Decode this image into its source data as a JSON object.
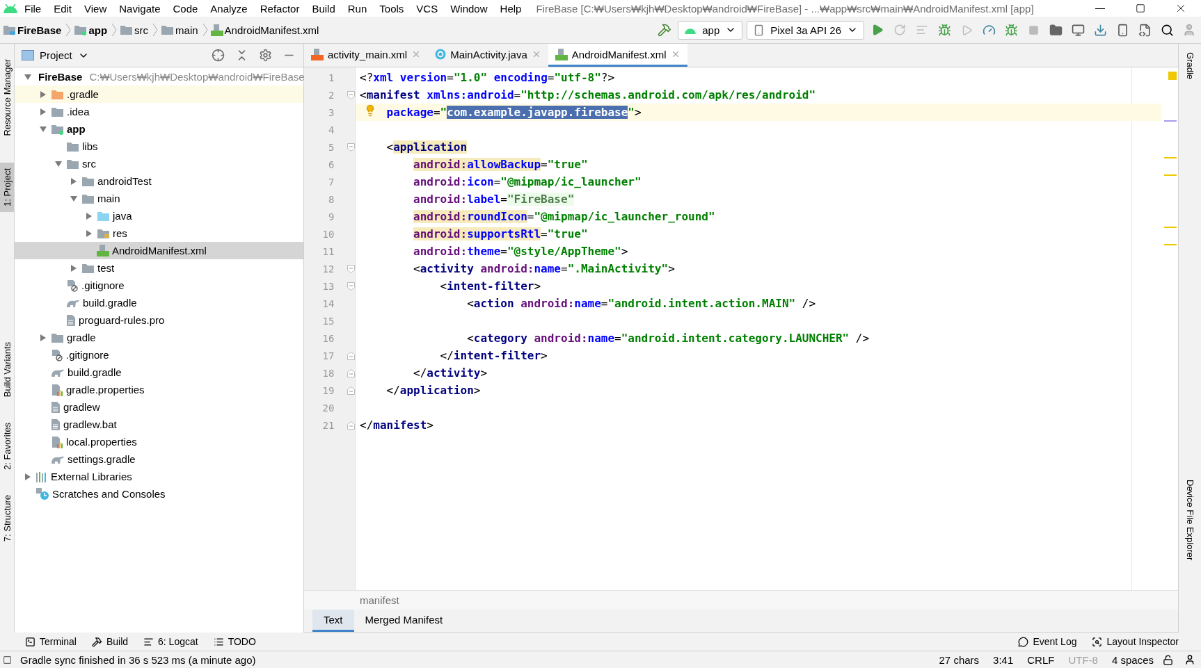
{
  "window": {
    "title": "FireBase [C:₩Users₩kjh₩Desktop₩android₩FireBase] - ...₩app₩src₩main₩AndroidManifest.xml [app]"
  },
  "menu": [
    "File",
    "Edit",
    "View",
    "Navigate",
    "Code",
    "Analyze",
    "Refactor",
    "Build",
    "Run",
    "Tools",
    "VCS",
    "Window",
    "Help"
  ],
  "breadcrumbs": [
    {
      "label": "FireBase",
      "kind": "project"
    },
    {
      "label": "app",
      "kind": "module"
    },
    {
      "label": "src",
      "kind": "folder"
    },
    {
      "label": "main",
      "kind": "folder"
    },
    {
      "label": "AndroidManifest.xml",
      "kind": "manifest"
    }
  ],
  "toolbar": {
    "run_config": "app",
    "device": "Pixel 3a API 26"
  },
  "left_stripe": [
    {
      "label": "Resource Manager",
      "selected": false
    },
    {
      "label": "1: Project",
      "selected": true
    },
    {
      "label": "Build Variants",
      "selected": false
    },
    {
      "label": "2: Favorites",
      "selected": false
    },
    {
      "label": "7: Structure",
      "selected": false
    }
  ],
  "right_stripe": [
    {
      "label": "Gradle",
      "selected": false
    },
    {
      "label": "Device File Explorer",
      "selected": false
    }
  ],
  "project_panel": {
    "title": "Project",
    "tree": [
      {
        "label": "FireBase",
        "hint": "C:₩Users₩kjh₩Desktop₩android₩FireBase",
        "kind": "project",
        "expanded": true,
        "selected": false,
        "highlighted": false,
        "children": [
          {
            "label": ".gradle",
            "kind": "excluded",
            "expanded": false,
            "selected": false,
            "highlighted": true
          },
          {
            "label": ".idea",
            "kind": "folder",
            "expanded": false,
            "selected": false,
            "highlighted": false
          },
          {
            "label": "app",
            "kind": "module",
            "expanded": true,
            "selected": false,
            "highlighted": false,
            "children": [
              {
                "label": "libs",
                "kind": "folder",
                "selected": false,
                "highlighted": false
              },
              {
                "label": "src",
                "kind": "folder",
                "expanded": true,
                "selected": false,
                "highlighted": false,
                "children": [
                  {
                    "label": "androidTest",
                    "kind": "folder",
                    "expanded": false,
                    "selected": false,
                    "highlighted": false
                  },
                  {
                    "label": "main",
                    "kind": "folder",
                    "expanded": true,
                    "selected": false,
                    "highlighted": false,
                    "children": [
                      {
                        "label": "java",
                        "kind": "source",
                        "expanded": false,
                        "selected": false,
                        "highlighted": false
                      },
                      {
                        "label": "res",
                        "kind": "resources",
                        "expanded": false,
                        "selected": false,
                        "highlighted": false
                      },
                      {
                        "label": "AndroidManifest.xml",
                        "kind": "manifest",
                        "selected": true,
                        "highlighted": false
                      }
                    ]
                  },
                  {
                    "label": "test",
                    "kind": "folder",
                    "expanded": false,
                    "selected": false,
                    "highlighted": false
                  }
                ]
              },
              {
                "label": ".gitignore",
                "kind": "gitignore",
                "selected": false,
                "highlighted": false
              },
              {
                "label": "build.gradle",
                "kind": "gradle",
                "selected": false,
                "highlighted": false
              },
              {
                "label": "proguard-rules.pro",
                "kind": "text",
                "selected": false,
                "highlighted": false
              }
            ]
          },
          {
            "label": "gradle",
            "kind": "folder",
            "expanded": false,
            "selected": false,
            "highlighted": false
          },
          {
            "label": ".gitignore",
            "kind": "gitignore",
            "selected": false,
            "highlighted": false
          },
          {
            "label": "build.gradle",
            "kind": "gradle",
            "selected": false,
            "highlighted": false
          },
          {
            "label": "gradle.properties",
            "kind": "properties",
            "selected": false,
            "highlighted": false
          },
          {
            "label": "gradlew",
            "kind": "text",
            "selected": false,
            "highlighted": false
          },
          {
            "label": "gradlew.bat",
            "kind": "text",
            "selected": false,
            "highlighted": false
          },
          {
            "label": "local.properties",
            "kind": "properties",
            "selected": false,
            "highlighted": false
          },
          {
            "label": "settings.gradle",
            "kind": "gradle",
            "selected": false,
            "highlighted": false
          }
        ]
      },
      {
        "label": "External Libraries",
        "kind": "libraries",
        "expanded": false,
        "selected": false,
        "highlighted": false
      },
      {
        "label": "Scratches and Consoles",
        "kind": "scratches",
        "selected": false,
        "highlighted": false
      }
    ]
  },
  "editor_tabs": [
    {
      "label": "activity_main.xml",
      "kind": "layout",
      "selected": false
    },
    {
      "label": "MainActivity.java",
      "kind": "class",
      "selected": false
    },
    {
      "label": "AndroidManifest.xml",
      "kind": "manifest",
      "selected": true
    }
  ],
  "code": [
    {
      "number": "1",
      "kind": "plain",
      "current": false,
      "tokens": [
        {
          "text": "<?",
          "kind": "punct"
        },
        {
          "text": "xml",
          "kind": "attr"
        },
        {
          "text": " version",
          "kind": "attr"
        },
        {
          "text": "=",
          "kind": "punct"
        },
        {
          "text": "\"1.0\"",
          "kind": "value"
        },
        {
          "text": " encoding",
          "kind": "attr"
        },
        {
          "text": "=",
          "kind": "punct"
        },
        {
          "text": "\"utf-8\"",
          "kind": "value"
        },
        {
          "text": "?>",
          "kind": "punct"
        }
      ]
    },
    {
      "number": "2",
      "kind": "fold-start",
      "current": false,
      "tokens": [
        {
          "text": "<",
          "kind": "punct"
        },
        {
          "text": "manifest",
          "kind": "tag"
        },
        {
          "text": " xmlns:android",
          "kind": "attr"
        },
        {
          "text": "=",
          "kind": "punct"
        },
        {
          "text": "\"http://schemas.android.com/apk/res/android\"",
          "kind": "value"
        }
      ]
    },
    {
      "number": "3",
      "kind": "plain",
      "current": true,
      "tokens": [
        {
          "text": "    package",
          "kind": "attr"
        },
        {
          "text": "=",
          "kind": "punct"
        },
        {
          "text": "\"",
          "kind": "value"
        },
        {
          "text": "com.example.javapp.firebase",
          "kind": "value",
          "selected": true
        },
        {
          "text": "\"",
          "kind": "value"
        },
        {
          "text": ">",
          "kind": "punct"
        }
      ]
    },
    {
      "number": "4",
      "kind": "plain",
      "current": false
    },
    {
      "number": "5",
      "kind": "fold-start",
      "current": false,
      "tokens": [
        {
          "text": "    <",
          "kind": "punct"
        },
        {
          "text": "application",
          "kind": "tag",
          "warning": true
        }
      ]
    },
    {
      "number": "6",
      "kind": "plain",
      "current": false,
      "tokens": [
        {
          "text": "        android:",
          "kind": "ns",
          "warning": true
        },
        {
          "text": "allowBackup",
          "kind": "attr",
          "warning": true
        },
        {
          "text": "=",
          "kind": "punct"
        },
        {
          "text": "\"true\"",
          "kind": "value"
        }
      ]
    },
    {
      "number": "7",
      "kind": "plain",
      "current": false,
      "tokens": [
        {
          "text": "        android:",
          "kind": "ns"
        },
        {
          "text": "icon",
          "kind": "attr"
        },
        {
          "text": "=",
          "kind": "punct"
        },
        {
          "text": "\"@mipmap/ic_launcher\"",
          "kind": "value"
        }
      ]
    },
    {
      "number": "8",
      "kind": "plain",
      "current": false,
      "tokens": [
        {
          "text": "        android:",
          "kind": "ns"
        },
        {
          "text": "label",
          "kind": "attr"
        },
        {
          "text": "=",
          "kind": "punct"
        },
        {
          "text": "\"FireBase\"",
          "kind": "value",
          "hardcoded": true
        }
      ]
    },
    {
      "number": "9",
      "kind": "plain",
      "current": false,
      "tokens": [
        {
          "text": "        android:",
          "kind": "ns",
          "warning": true
        },
        {
          "text": "roundIcon",
          "kind": "attr",
          "warning": true
        },
        {
          "text": "=",
          "kind": "punct"
        },
        {
          "text": "\"@mipmap/ic_launcher_round\"",
          "kind": "value"
        }
      ]
    },
    {
      "number": "10",
      "kind": "plain",
      "current": false,
      "tokens": [
        {
          "text": "        android:",
          "kind": "ns",
          "warning": true
        },
        {
          "text": "supportsRtl",
          "kind": "attr",
          "warning": true
        },
        {
          "text": "=",
          "kind": "punct"
        },
        {
          "text": "\"true\"",
          "kind": "value"
        }
      ]
    },
    {
      "number": "11",
      "kind": "plain",
      "current": false,
      "tokens": [
        {
          "text": "        android:",
          "kind": "ns"
        },
        {
          "text": "theme",
          "kind": "attr"
        },
        {
          "text": "=",
          "kind": "punct"
        },
        {
          "text": "\"@style/AppTheme\"",
          "kind": "value"
        },
        {
          "text": ">",
          "kind": "punct"
        }
      ]
    },
    {
      "number": "12",
      "kind": "fold-start",
      "current": false,
      "tokens": [
        {
          "text": "        <",
          "kind": "punct"
        },
        {
          "text": "activity",
          "kind": "tag"
        },
        {
          "text": " android:",
          "kind": "ns"
        },
        {
          "text": "name",
          "kind": "attr"
        },
        {
          "text": "=",
          "kind": "punct"
        },
        {
          "text": "\".MainActivity\"",
          "kind": "value"
        },
        {
          "text": ">",
          "kind": "punct"
        }
      ]
    },
    {
      "number": "13",
      "kind": "fold-start",
      "current": false,
      "tokens": [
        {
          "text": "            <",
          "kind": "punct"
        },
        {
          "text": "intent-filter",
          "kind": "tag"
        },
        {
          "text": ">",
          "kind": "punct"
        }
      ]
    },
    {
      "number": "14",
      "kind": "plain",
      "current": false,
      "tokens": [
        {
          "text": "                <",
          "kind": "punct"
        },
        {
          "text": "action",
          "kind": "tag"
        },
        {
          "text": " android:",
          "kind": "ns"
        },
        {
          "text": "name",
          "kind": "attr"
        },
        {
          "text": "=",
          "kind": "punct"
        },
        {
          "text": "\"android.intent.action.MAIN\"",
          "kind": "value"
        },
        {
          "text": " />",
          "kind": "punct"
        }
      ]
    },
    {
      "number": "15",
      "kind": "plain",
      "current": false
    },
    {
      "number": "16",
      "kind": "plain",
      "current": false,
      "tokens": [
        {
          "text": "                <",
          "kind": "punct"
        },
        {
          "text": "category",
          "kind": "tag"
        },
        {
          "text": " android:",
          "kind": "ns"
        },
        {
          "text": "name",
          "kind": "attr"
        },
        {
          "text": "=",
          "kind": "punct"
        },
        {
          "text": "\"android.intent.category.LAUNCHER\"",
          "kind": "value"
        },
        {
          "text": " />",
          "kind": "punct"
        }
      ]
    },
    {
      "number": "17",
      "kind": "fold-end",
      "current": false,
      "tokens": [
        {
          "text": "            </",
          "kind": "punct"
        },
        {
          "text": "intent-filter",
          "kind": "tag"
        },
        {
          "text": ">",
          "kind": "punct"
        }
      ]
    },
    {
      "number": "18",
      "kind": "fold-end",
      "current": false,
      "tokens": [
        {
          "text": "        </",
          "kind": "punct"
        },
        {
          "text": "activity",
          "kind": "tag"
        },
        {
          "text": ">",
          "kind": "punct"
        }
      ]
    },
    {
      "number": "19",
      "kind": "fold-end",
      "current": false,
      "tokens": [
        {
          "text": "    </",
          "kind": "punct"
        },
        {
          "text": "application",
          "kind": "tag"
        },
        {
          "text": ">",
          "kind": "punct"
        }
      ]
    },
    {
      "number": "20",
      "kind": "plain",
      "current": false
    },
    {
      "number": "21",
      "kind": "fold-end",
      "current": false,
      "tokens": [
        {
          "text": "</",
          "kind": "punct"
        },
        {
          "text": "manifest",
          "kind": "tag"
        },
        {
          "text": ">",
          "kind": "punct"
        }
      ]
    }
  ],
  "editor_breadcrumb": "manifest",
  "editor_bottom_tabs": [
    {
      "label": "Text",
      "selected": true
    },
    {
      "label": "Merged Manifest",
      "selected": false
    }
  ],
  "tool_windows_left": [
    {
      "label": "Terminal",
      "kind": "terminal"
    },
    {
      "label": "Build",
      "kind": "hammer"
    },
    {
      "label": "6: Logcat",
      "kind": "lines"
    },
    {
      "label": "TODO",
      "kind": "list"
    }
  ],
  "tool_windows_right": [
    {
      "label": "Event Log",
      "kind": "bubble"
    },
    {
      "label": "Layout Inspector",
      "kind": "inspector"
    }
  ],
  "status_bar": {
    "message": "Gradle sync finished in 36 s 523 ms (a minute ago)",
    "items": [
      {
        "label": "27 chars",
        "disabled": false
      },
      {
        "label": "3:41",
        "disabled": false
      },
      {
        "label": "CRLF",
        "disabled": false
      },
      {
        "label": "UTF-8",
        "disabled": true
      },
      {
        "label": "4 spaces",
        "disabled": false
      }
    ]
  }
}
